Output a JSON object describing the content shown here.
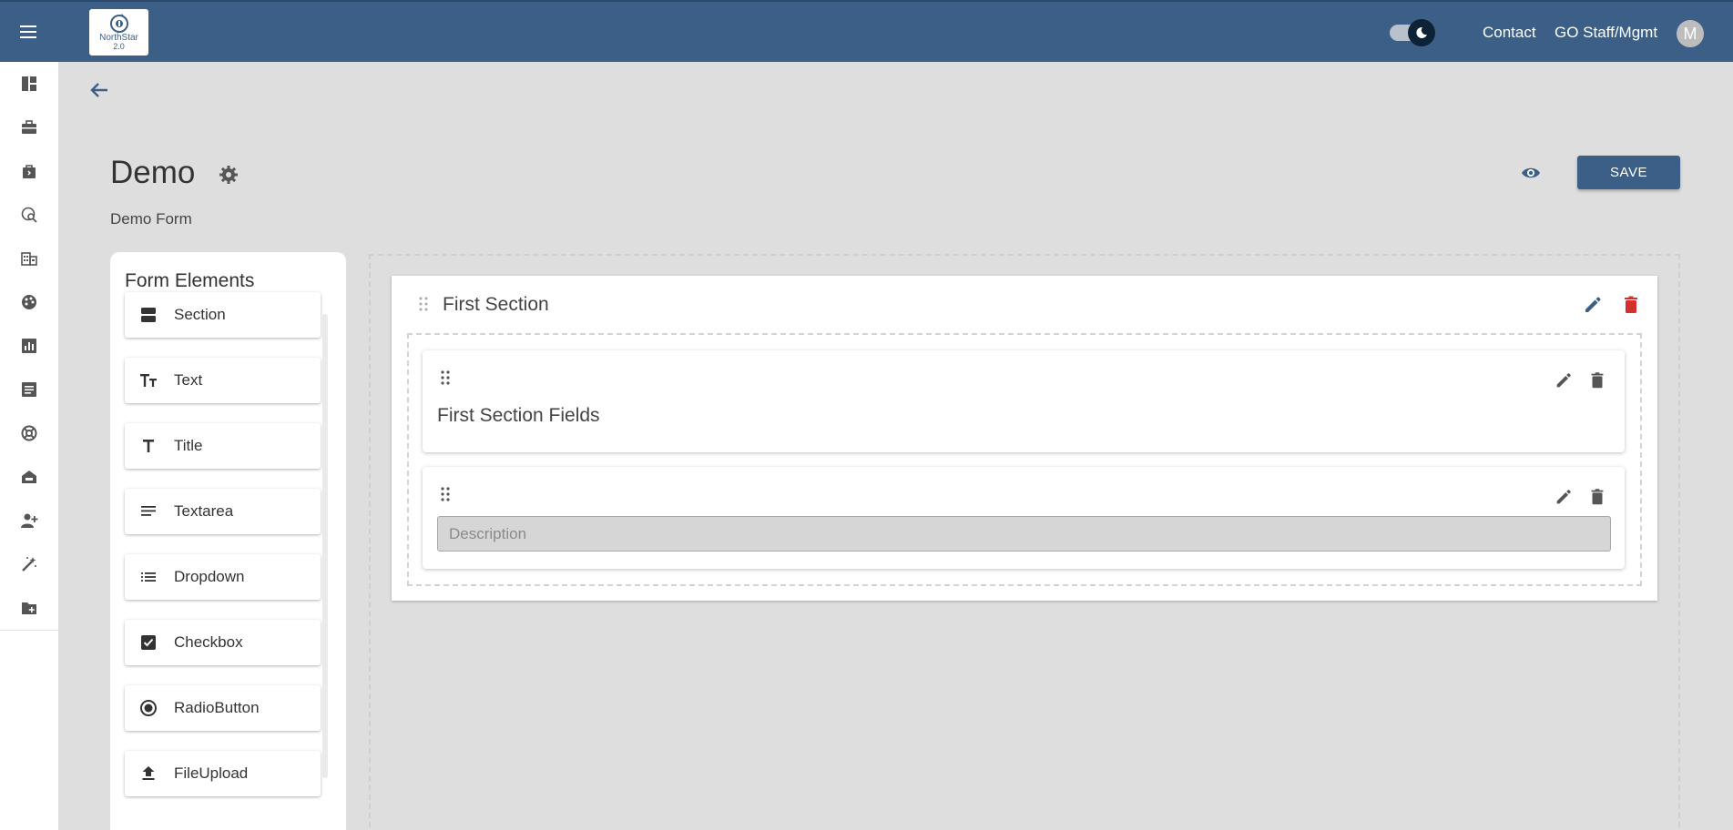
{
  "header": {
    "logo_brand": "NorthStar",
    "logo_version": "2.0",
    "theme_toggle": "dark-mode",
    "links": [
      "Contact",
      "GO Staff/Mgmt"
    ],
    "avatar_initial": "M"
  },
  "sidebar": {
    "icons": [
      "dashboard-icon",
      "briefcase-icon",
      "bag-icon",
      "search-globe-icon",
      "domain-icon",
      "palette-icon",
      "chart-icon",
      "article-icon",
      "support-icon",
      "house-icon",
      "add-person-icon",
      "magic-wand-icon",
      "folder-add-icon"
    ]
  },
  "page": {
    "title": "Demo",
    "subtitle": "Demo Form",
    "save_label": "SAVE"
  },
  "form_elements": {
    "title": "Form Elements",
    "items": [
      {
        "label": "Section",
        "icon": "section-icon"
      },
      {
        "label": "Text",
        "icon": "text-fields-icon"
      },
      {
        "label": "Title",
        "icon": "title-icon"
      },
      {
        "label": "Textarea",
        "icon": "subject-icon"
      },
      {
        "label": "Dropdown",
        "icon": "list-icon"
      },
      {
        "label": "Checkbox",
        "icon": "checkbox-icon"
      },
      {
        "label": "RadioButton",
        "icon": "radio-icon"
      },
      {
        "label": "FileUpload",
        "icon": "upload-icon"
      }
    ]
  },
  "canvas": {
    "section_title": "First Section",
    "fields": [
      {
        "text": "First Section Fields"
      },
      {
        "placeholder": "Description"
      }
    ]
  },
  "colors": {
    "primary": "#3b5f86",
    "delete_red": "#d32f2f",
    "background": "#dedede"
  }
}
